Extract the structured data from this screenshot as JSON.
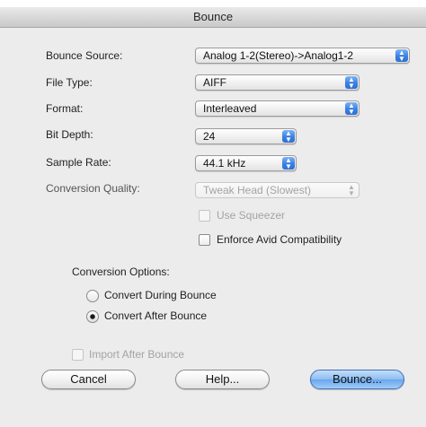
{
  "window": {
    "title": "Bounce"
  },
  "form": {
    "bounce_source": {
      "label": "Bounce Source:",
      "value": "Analog 1-2(Stereo)->Analog1-2"
    },
    "file_type": {
      "label": "File Type:",
      "value": "AIFF"
    },
    "format": {
      "label": "Format:",
      "value": "Interleaved"
    },
    "bit_depth": {
      "label": "Bit Depth:",
      "value": "24"
    },
    "sample_rate": {
      "label": "Sample Rate:",
      "value": "44.1 kHz"
    },
    "conversion_quality": {
      "label": "Conversion Quality:",
      "value": "Tweak Head (Slowest)",
      "enabled": false
    },
    "use_squeezer": {
      "label": "Use Squeezer",
      "checked": false,
      "enabled": false
    },
    "enforce_avid": {
      "label": "Enforce Avid Compatibility",
      "checked": false
    }
  },
  "conversion_options": {
    "label": "Conversion Options:",
    "options": [
      {
        "label": "Convert During Bounce",
        "selected": false
      },
      {
        "label": "Convert After Bounce",
        "selected": true
      }
    ]
  },
  "import_after_bounce": {
    "label": "Import After Bounce",
    "checked": false,
    "enabled": false
  },
  "buttons": {
    "cancel": "Cancel",
    "help": "Help...",
    "bounce": "Bounce..."
  },
  "icons": {
    "popup_arrows": "▲▼"
  },
  "colors": {
    "accent": "#3a80e2",
    "dialog_bg": "#ececec",
    "disabled_text": "#a3a3a3"
  }
}
